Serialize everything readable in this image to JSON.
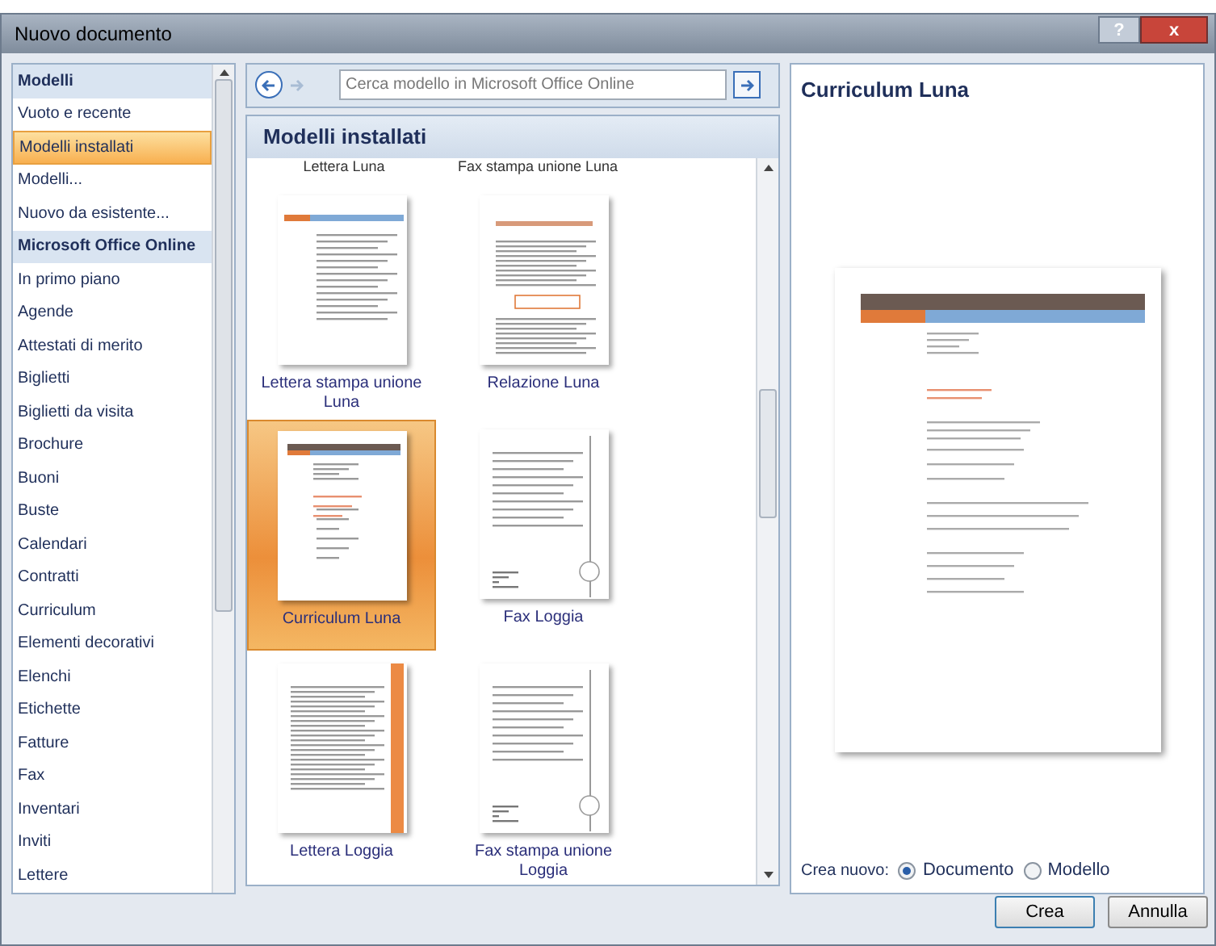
{
  "window": {
    "title": "Nuovo documento",
    "help": "?",
    "close": "x"
  },
  "sidebar": {
    "items": [
      {
        "label": "Modelli",
        "kind": "header",
        "selected": false
      },
      {
        "label": "Vuoto e recente",
        "kind": "item",
        "selected": false
      },
      {
        "label": "Modelli installati",
        "kind": "item",
        "selected": true
      },
      {
        "label": "Modelli...",
        "kind": "item",
        "selected": false
      },
      {
        "label": "Nuovo da esistente...",
        "kind": "item",
        "selected": false
      },
      {
        "label": "Microsoft Office Online",
        "kind": "header",
        "selected": false
      },
      {
        "label": "In primo piano",
        "kind": "item",
        "selected": false
      },
      {
        "label": "Agende",
        "kind": "item",
        "selected": false
      },
      {
        "label": "Attestati di merito",
        "kind": "item",
        "selected": false
      },
      {
        "label": "Biglietti",
        "kind": "item",
        "selected": false
      },
      {
        "label": "Biglietti da visita",
        "kind": "item",
        "selected": false
      },
      {
        "label": "Brochure",
        "kind": "item",
        "selected": false
      },
      {
        "label": "Buoni",
        "kind": "item",
        "selected": false
      },
      {
        "label": "Buste",
        "kind": "item",
        "selected": false
      },
      {
        "label": "Calendari",
        "kind": "item",
        "selected": false
      },
      {
        "label": "Contratti",
        "kind": "item",
        "selected": false
      },
      {
        "label": "Curriculum",
        "kind": "item",
        "selected": false
      },
      {
        "label": "Elementi decorativi",
        "kind": "item",
        "selected": false
      },
      {
        "label": "Elenchi",
        "kind": "item",
        "selected": false
      },
      {
        "label": "Etichette",
        "kind": "item",
        "selected": false
      },
      {
        "label": "Fatture",
        "kind": "item",
        "selected": false
      },
      {
        "label": "Fax",
        "kind": "item",
        "selected": false
      },
      {
        "label": "Inventari",
        "kind": "item",
        "selected": false
      },
      {
        "label": "Inviti",
        "kind": "item",
        "selected": false
      },
      {
        "label": "Lettere",
        "kind": "item",
        "selected": false
      }
    ]
  },
  "search": {
    "placeholder": "Cerca modello in Microsoft Office Online"
  },
  "gallery": {
    "title": "Modelli installati",
    "cut_labels": [
      "Lettera Luna",
      "Fax stampa unione Luna"
    ],
    "templates": [
      {
        "label": "Lettera stampa unione Luna",
        "kind": "letter",
        "selected": false
      },
      {
        "label": "Relazione Luna",
        "kind": "report",
        "selected": false
      },
      {
        "label": "Curriculum Luna",
        "kind": "resume",
        "selected": true
      },
      {
        "label": "Fax Loggia",
        "kind": "fax",
        "selected": false
      },
      {
        "label": "Lettera Loggia",
        "kind": "loggia",
        "selected": false
      },
      {
        "label": "Fax stampa unione Loggia",
        "kind": "fax",
        "selected": false
      }
    ]
  },
  "preview": {
    "title": "Curriculum Luna"
  },
  "create_new": {
    "label": "Crea nuovo:",
    "options": [
      {
        "label": "Documento",
        "selected": true
      },
      {
        "label": "Modello",
        "selected": false
      }
    ]
  },
  "buttons": [
    "Crea",
    "Annulla"
  ]
}
